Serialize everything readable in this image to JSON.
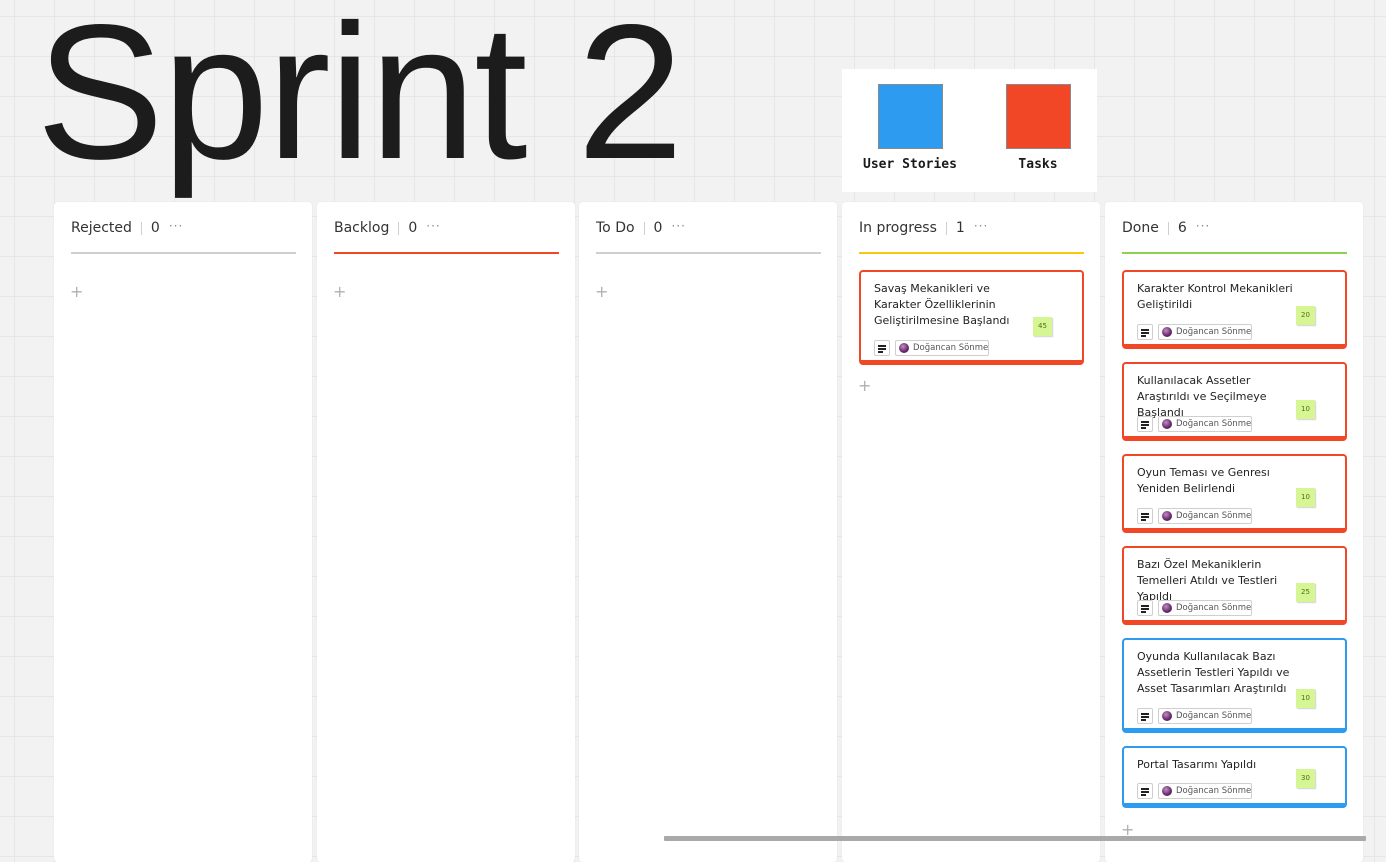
{
  "board": {
    "title": "Sprint 2"
  },
  "legend": {
    "items": [
      {
        "label": "User Stories",
        "color": "#2d9bf0"
      },
      {
        "label": "Tasks",
        "color": "#f24726"
      }
    ]
  },
  "columns": [
    {
      "title": "Rejected",
      "count": "0",
      "menu": "···",
      "add": "+",
      "color": "#cfcfcf",
      "cards": []
    },
    {
      "title": "Backlog",
      "count": "0",
      "menu": "···",
      "add": "+",
      "color": "#f24726",
      "cards": []
    },
    {
      "title": "To Do",
      "count": "0",
      "menu": "···",
      "add": "+",
      "color": "#cfcfcf",
      "cards": []
    },
    {
      "title": "In progress",
      "count": "1",
      "menu": "···",
      "add": "+",
      "color": "#fac710",
      "cards": [
        {
          "text": "Savaş Mekanikleri ve Karakter Özelliklerinin Geliştirilmesine Başlandı",
          "assignee": "Doğancan Sönmez",
          "points": "45",
          "type": "task"
        }
      ]
    },
    {
      "title": "Done",
      "count": "6",
      "menu": "···",
      "add": "+",
      "color": "#8fd14f",
      "cards": [
        {
          "text": "Karakter Kontrol Mekanikleri Geliştirildi",
          "assignee": "Doğancan Sönmez",
          "points": "20",
          "type": "task"
        },
        {
          "text": "Kullanılacak Assetler Araştırıldı ve Seçilmeye Başlandı",
          "assignee": "Doğancan Sönmez",
          "points": "10",
          "type": "task"
        },
        {
          "text": "Oyun Teması ve Genresı Yeniden Belirlendi",
          "assignee": "Doğancan Sönmez",
          "points": "10",
          "type": "task"
        },
        {
          "text": "Bazı Özel Mekaniklerin Temelleri Atıldı ve Testleri Yapıldı",
          "assignee": "Doğancan Sönmez",
          "points": "25",
          "type": "task"
        },
        {
          "text": "Oyunda Kullanılacak Bazı Assetlerin Testleri Yapıldı ve Asset Tasarımları Araştırıldı",
          "assignee": "Doğancan Sönmez",
          "points": "10",
          "type": "story"
        },
        {
          "text": "Portal Tasarımı Yapıldı",
          "assignee": "Doğancan Sönmez",
          "points": "30",
          "type": "story"
        }
      ]
    }
  ]
}
